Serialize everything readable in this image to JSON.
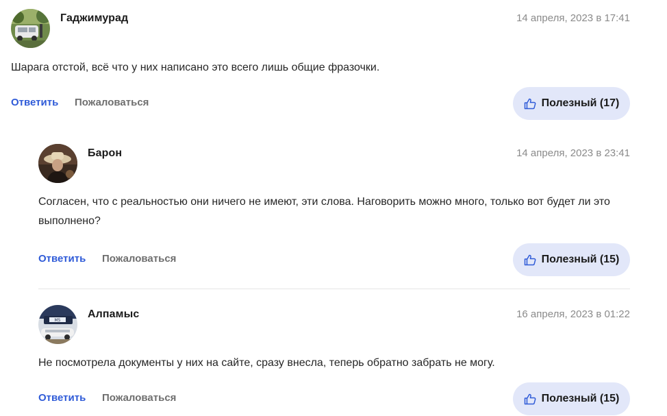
{
  "comments": [
    {
      "author": "Гаджимурад",
      "date": "14 апреля, 2023 в 17:41",
      "text": "Шарага отстой, всё что у них написано это всего лишь общие фразочки.",
      "reply_label": "Ответить",
      "complain_label": "Пожаловаться",
      "useful_label": "Полезный (17)"
    },
    {
      "author": "Барон",
      "date": "14 апреля, 2023 в 23:41",
      "text": "Согласен, что с реальностью они ничего не имеют, эти слова. Наговорить можно много, только вот будет ли это выполнено?",
      "reply_label": "Ответить",
      "complain_label": "Пожаловаться",
      "useful_label": "Полезный (15)"
    },
    {
      "author": "Алпамыс",
      "date": "16 апреля, 2023 в 01:22",
      "text": "Не посмотрела документы у них на сайте, сразу внесла, теперь обратно забрать не могу.",
      "reply_label": "Ответить",
      "complain_label": "Пожаловаться",
      "useful_label": "Полезный (15)"
    }
  ],
  "colors": {
    "link": "#2f5bd8",
    "muted": "#6e6e6e",
    "date": "#8a8a8a",
    "useful_bg": "#e2e7f9"
  },
  "icons": {
    "useful": "thumbs-up-icon"
  }
}
